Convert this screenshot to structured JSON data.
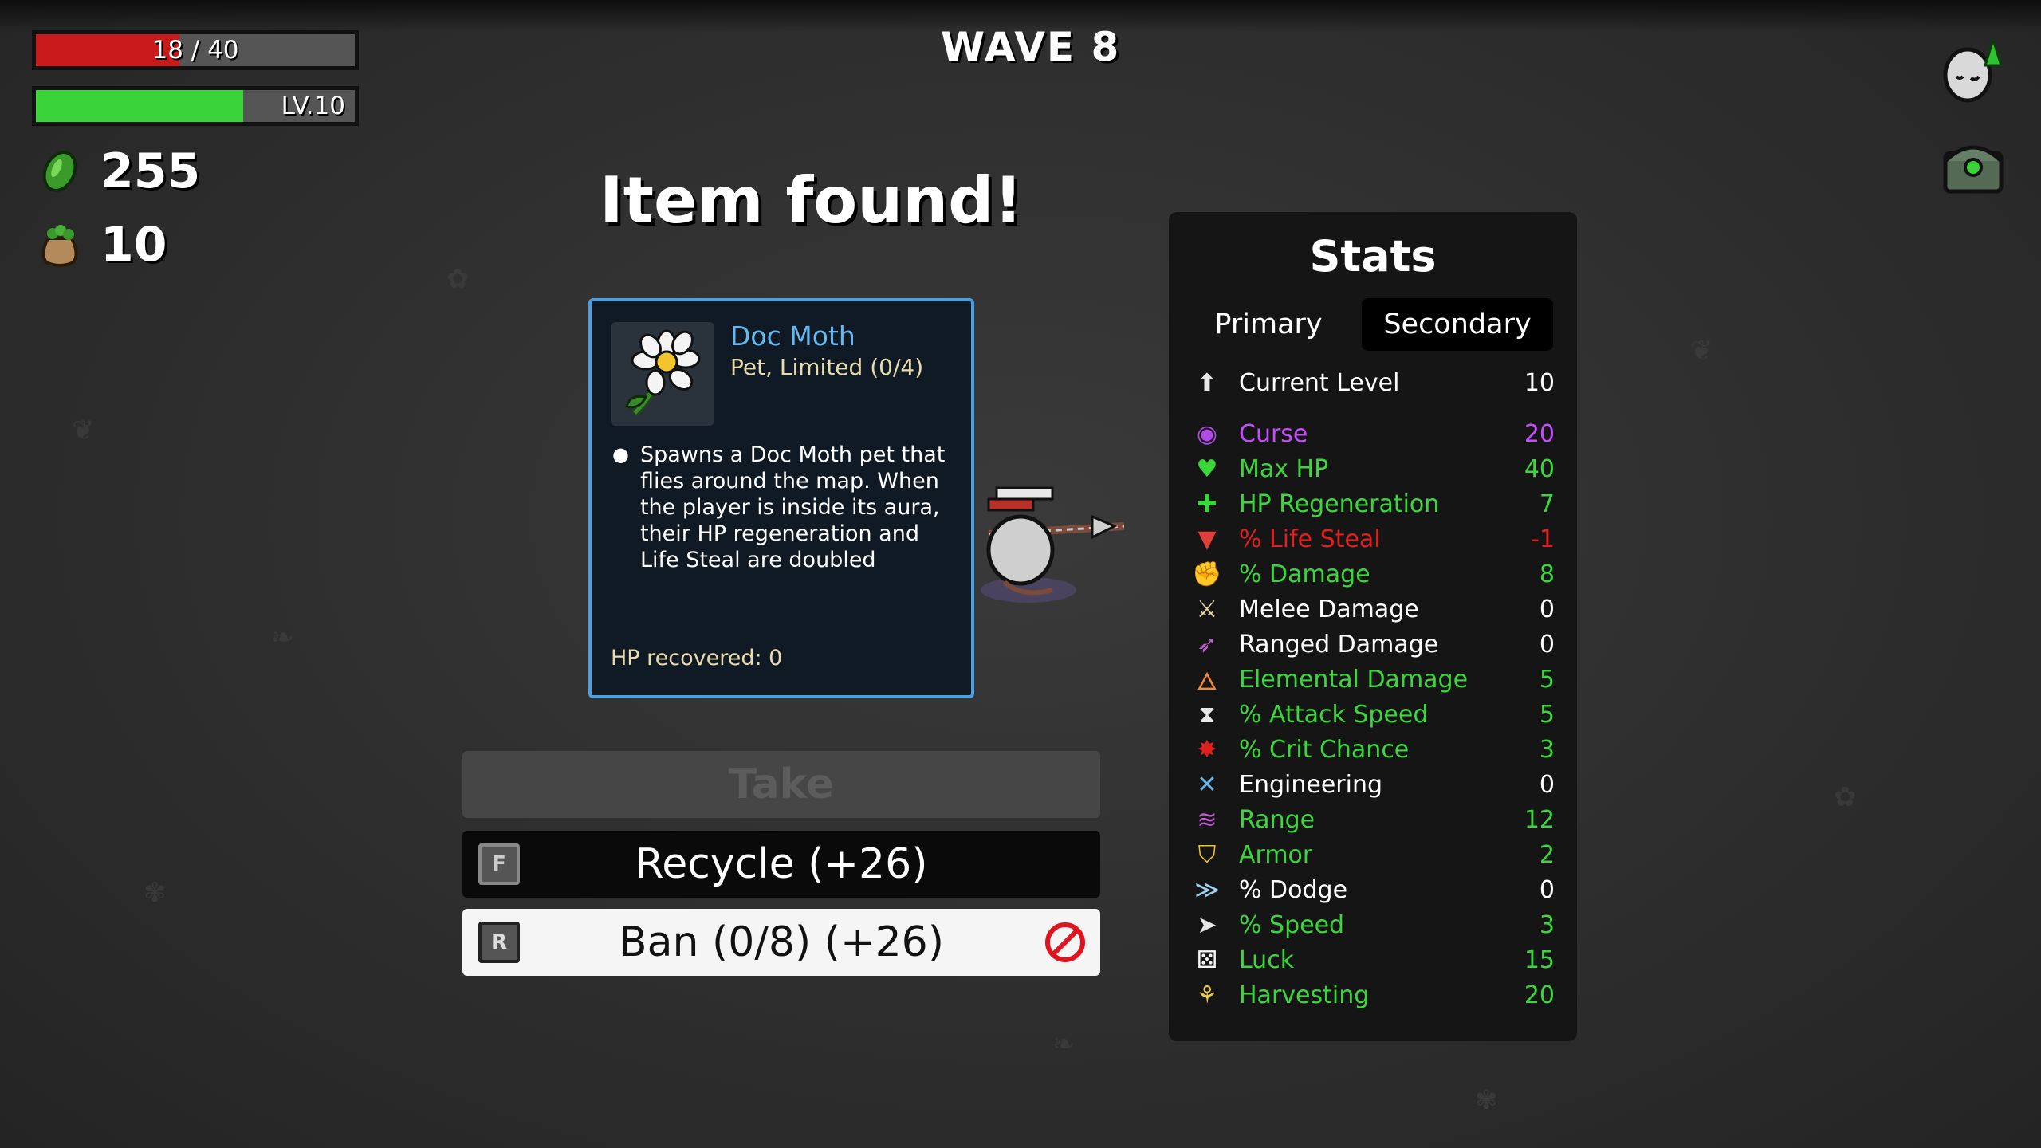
{
  "hud": {
    "hp_text": "18 / 40",
    "hp_fraction": 0.45,
    "level_text": "LV.10",
    "xp_fraction": 0.65,
    "materials": "255",
    "bag": "10"
  },
  "wave": "WAVE 8",
  "title": "Item found!",
  "item": {
    "name": "Doc Moth",
    "type": "Pet, Limited (0/4)",
    "description": "Spawns a Doc Moth pet that flies around the map. When the player is inside its aura, their HP regeneration and Life Steal are doubled",
    "hp_recovered": "HP recovered: 0",
    "icon": "daisy-flower-icon"
  },
  "buttons": {
    "take": "Take",
    "recycle": "Recycle (+26)",
    "recycle_key": "F",
    "ban": "Ban (0/8) (+26)",
    "ban_key": "R"
  },
  "stats": {
    "heading": "Stats",
    "tab_primary": "Primary",
    "tab_secondary": "Secondary",
    "rows": [
      {
        "label": "Current Level",
        "value": "10",
        "color": "#ffffff",
        "icon": "level-up-icon"
      },
      {
        "label": "Curse",
        "value": "20",
        "color": "#c54bff",
        "icon": "curse-eye-icon"
      },
      {
        "label": "Max HP",
        "value": "40",
        "color": "#3bd63b",
        "icon": "heart-icon"
      },
      {
        "label": "HP Regeneration",
        "value": "7",
        "color": "#3bd63b",
        "icon": "heart-plus-icon"
      },
      {
        "label": "% Life Steal",
        "value": "-1",
        "color": "#e0201e",
        "icon": "fangs-icon"
      },
      {
        "label": "% Damage",
        "value": "8",
        "color": "#3bd63b",
        "icon": "muscle-icon"
      },
      {
        "label": "Melee Damage",
        "value": "0",
        "color": "#ffffff",
        "icon": "sword-icon"
      },
      {
        "label": "Ranged Damage",
        "value": "0",
        "color": "#ffffff",
        "icon": "bow-icon"
      },
      {
        "label": "Elemental Damage",
        "value": "5",
        "color": "#3bd63b",
        "icon": "flame-icon"
      },
      {
        "label": "% Attack Speed",
        "value": "5",
        "color": "#3bd63b",
        "icon": "hourglass-icon"
      },
      {
        "label": "% Crit Chance",
        "value": "3",
        "color": "#3bd63b",
        "icon": "crit-burst-icon"
      },
      {
        "label": "Engineering",
        "value": "0",
        "color": "#ffffff",
        "icon": "wrench-cross-icon"
      },
      {
        "label": "Range",
        "value": "12",
        "color": "#3bd63b",
        "icon": "range-waves-icon"
      },
      {
        "label": "Armor",
        "value": "2",
        "color": "#3bd63b",
        "icon": "shield-icon"
      },
      {
        "label": "% Dodge",
        "value": "0",
        "color": "#ffffff",
        "icon": "dodge-icon"
      },
      {
        "label": "% Speed",
        "value": "3",
        "color": "#3bd63b",
        "icon": "boot-icon"
      },
      {
        "label": "Luck",
        "value": "15",
        "color": "#3bd63b",
        "icon": "dice-icon"
      },
      {
        "label": "Harvesting",
        "value": "20",
        "color": "#3bd63b",
        "icon": "wheat-icon"
      }
    ]
  }
}
